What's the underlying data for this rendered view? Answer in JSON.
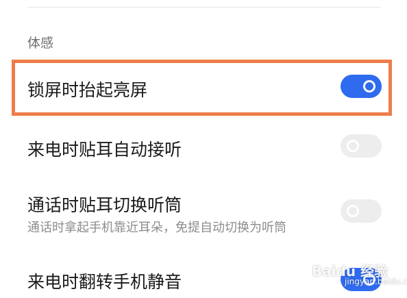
{
  "section": {
    "title": "体感"
  },
  "rows": [
    {
      "title": "锁屏时抬起亮屏",
      "toggle": "on"
    },
    {
      "title": "来电时贴耳自动接听",
      "toggle": "off"
    },
    {
      "title": "通话时贴耳切换听筒",
      "subtitle": "通话时拿起手机靠近耳朵，免提自动切换为听筒",
      "toggle": "off"
    },
    {
      "title": "来电时翻转手机静音",
      "toggle": "on"
    }
  ],
  "watermark": {
    "text": "Baidu 经验",
    "url": "jingyan.baidu.com"
  },
  "colors": {
    "accent": "#2f6bef",
    "highlight": "#ee7d4a",
    "toggle_off": "#ededed"
  }
}
